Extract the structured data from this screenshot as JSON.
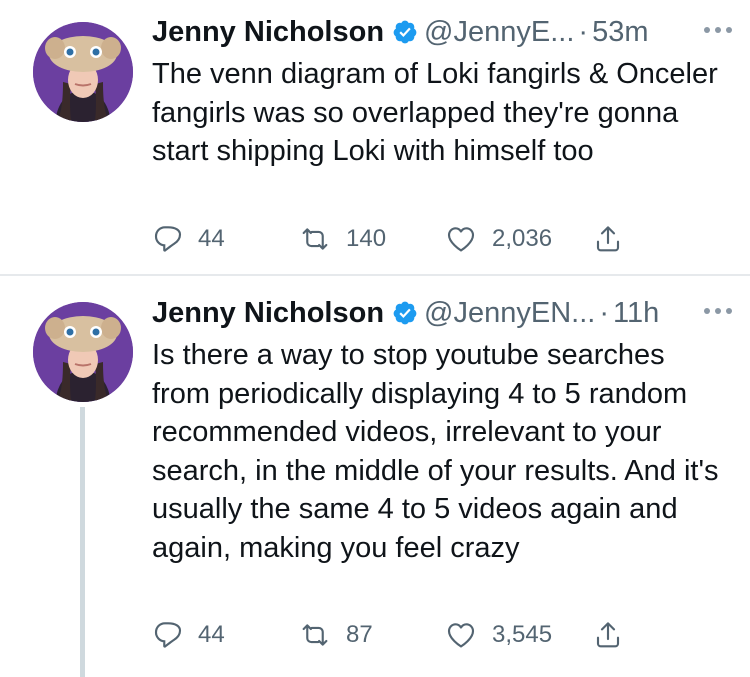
{
  "tweets": [
    {
      "name": "Jenny Nicholson",
      "handle": "@JennyE...",
      "separator": "·",
      "time": "53m",
      "text": "The venn diagram of Loki fangirls & Onceler fangirls was so overlapped they're gonna start shipping Loki with himself too",
      "replies": "44",
      "retweets": "140",
      "likes": "2,036"
    },
    {
      "name": "Jenny Nicholson",
      "handle": "@JennyEN...",
      "separator": "·",
      "time": "11h",
      "text": "Is there a way to stop youtube searches from periodically displaying 4 to 5 random recommended videos, irrelevant to your search, in the middle of your results. And it's usually the same 4 to 5 videos again and again, making you feel crazy",
      "replies": "44",
      "retweets": "87",
      "likes": "3,545"
    }
  ],
  "icons": {
    "verified": "verified-badge-icon",
    "more": "more-options-icon",
    "reply": "reply-icon",
    "retweet": "retweet-icon",
    "like": "heart-icon",
    "share": "share-icon"
  },
  "colors": {
    "text": "#0f1419",
    "secondary": "#536471",
    "verified": "#1d9bf0",
    "divider": "#e6e9ec",
    "thread_line": "#cfd9de",
    "avatar_bg": "#6b3fa0"
  }
}
